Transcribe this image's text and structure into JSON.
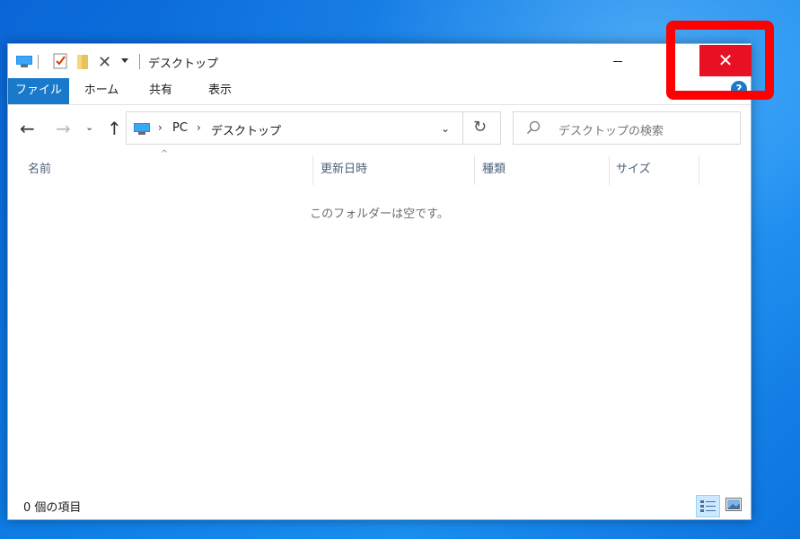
{
  "window": {
    "title": "デスクトップ"
  },
  "titlebar": {
    "close_glyph": "✕",
    "minimize_icon": "minimize-icon"
  },
  "quick_access": {
    "delete_glyph": "✕"
  },
  "ribbon": {
    "tabs": [
      {
        "label": "ファイル",
        "active": true
      },
      {
        "label": "ホーム"
      },
      {
        "label": "共有"
      },
      {
        "label": "表示"
      }
    ],
    "help_label": "?",
    "expand_glyph": "⌄"
  },
  "nav": {
    "back_glyph": "←",
    "forward_glyph": "→",
    "recent_glyph": "⌄",
    "up_glyph": "↑",
    "refresh_glyph": "↻"
  },
  "address": {
    "segments": [
      "PC",
      "デスクトップ"
    ],
    "separator": "›",
    "dropdown_glyph": "⌄"
  },
  "search": {
    "placeholder": "デスクトップの検索"
  },
  "columns": {
    "name": "名前",
    "date": "更新日時",
    "type": "種類",
    "size": "サイズ",
    "sort_glyph": "^"
  },
  "content": {
    "empty_message": "このフォルダーは空です。"
  },
  "status": {
    "item_count": "0 個の項目"
  },
  "colors": {
    "accent": "#1979ca",
    "close_red": "#e81123",
    "highlight": "#ff0000",
    "desktop_blue": "#0f7fe6"
  }
}
